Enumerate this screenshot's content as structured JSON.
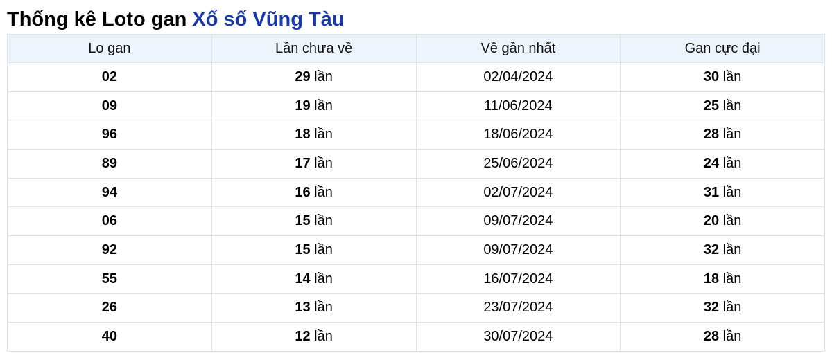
{
  "title": {
    "prefix": "Thống kê Loto gan",
    "highlight": "Xổ số Vũng Tàu"
  },
  "colors": {
    "accent": "#1a3aa0",
    "header_bg": "#eef4fb",
    "border": "#dfe3e8"
  },
  "table": {
    "columns": [
      "Lo gan",
      "Lần chưa về",
      "Về gần nhất",
      "Gan cực đại"
    ],
    "unit": "lần",
    "rows": [
      {
        "lo": "02",
        "chua_ve": "29",
        "gan_nhat": "02/04/2024",
        "cuc_dai": "30"
      },
      {
        "lo": "09",
        "chua_ve": "19",
        "gan_nhat": "11/06/2024",
        "cuc_dai": "25"
      },
      {
        "lo": "96",
        "chua_ve": "18",
        "gan_nhat": "18/06/2024",
        "cuc_dai": "28"
      },
      {
        "lo": "89",
        "chua_ve": "17",
        "gan_nhat": "25/06/2024",
        "cuc_dai": "24"
      },
      {
        "lo": "94",
        "chua_ve": "16",
        "gan_nhat": "02/07/2024",
        "cuc_dai": "31"
      },
      {
        "lo": "06",
        "chua_ve": "15",
        "gan_nhat": "09/07/2024",
        "cuc_dai": "20"
      },
      {
        "lo": "92",
        "chua_ve": "15",
        "gan_nhat": "09/07/2024",
        "cuc_dai": "32"
      },
      {
        "lo": "55",
        "chua_ve": "14",
        "gan_nhat": "16/07/2024",
        "cuc_dai": "18"
      },
      {
        "lo": "26",
        "chua_ve": "13",
        "gan_nhat": "23/07/2024",
        "cuc_dai": "32"
      },
      {
        "lo": "40",
        "chua_ve": "12",
        "gan_nhat": "30/07/2024",
        "cuc_dai": "28"
      }
    ]
  }
}
